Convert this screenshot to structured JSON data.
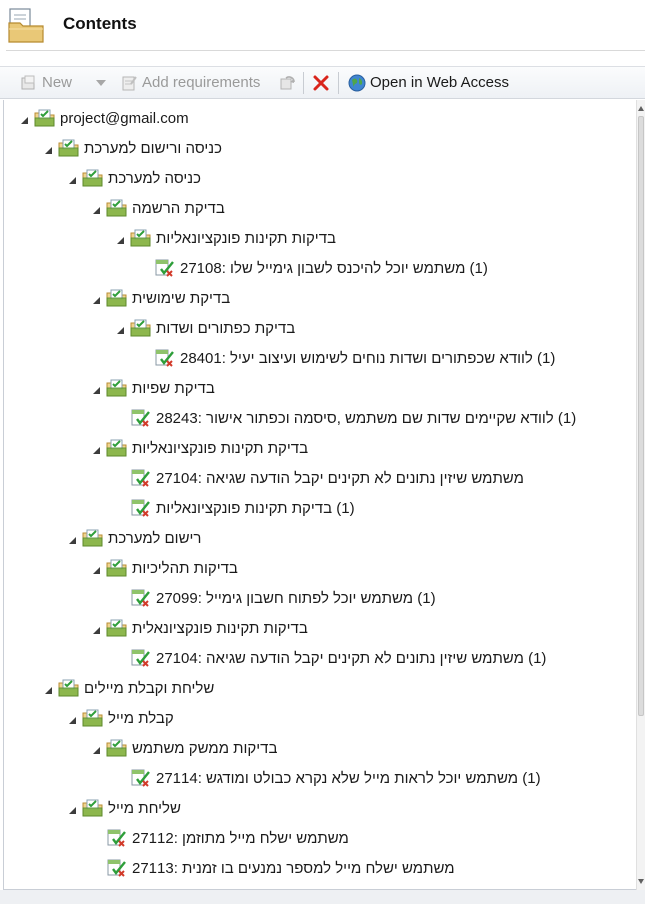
{
  "header": {
    "title": "Contents"
  },
  "toolbar": {
    "new_label": "New",
    "add_requirements_label": "Add requirements",
    "open_web_access_label": "Open in Web Access"
  },
  "tree": {
    "items": [
      {
        "label": "project@gmail.com",
        "type": "folder",
        "expanded": true,
        "level": 0
      },
      {
        "label": "כניסה ורישום למערכת",
        "type": "folder",
        "expanded": true,
        "level": 1
      },
      {
        "label": "כניסה למערכת",
        "type": "folder",
        "expanded": true,
        "level": 2
      },
      {
        "label": "בדיקת הרשמה",
        "type": "folder",
        "expanded": true,
        "level": 3
      },
      {
        "label": "בדיקות תקינות פונקציונאליות",
        "type": "folder",
        "expanded": true,
        "level": 4
      },
      {
        "label": "(1) משתמש יוכל להיכנס לשבון גימייל שלו :27108",
        "type": "test",
        "level": 5
      },
      {
        "label": "בדיקת שימושית",
        "type": "folder",
        "expanded": true,
        "level": 3
      },
      {
        "label": "בדיקת כפתורים ושדות",
        "type": "folder",
        "expanded": true,
        "level": 4
      },
      {
        "label": "(1) לוודא שכפתורים ושדות נוחים לשימוש ועיצוב יעיל :28401",
        "type": "test",
        "level": 5
      },
      {
        "label": "בדיקת שפיות",
        "type": "folder",
        "expanded": true,
        "level": 3
      },
      {
        "label": "(1) לוודא שקיימים שדות שם משתמש ,סיסמה וכפתור אישור :28243",
        "type": "test",
        "level": 4
      },
      {
        "label": "בדיקת תקינות פונקציונאליות",
        "type": "folder",
        "expanded": true,
        "level": 3
      },
      {
        "label": "משתמש שיזין נתונים לא תקינים יקבל הודעה שגיאה :27104",
        "type": "test",
        "level": 4
      },
      {
        "label": "(1) בדיקת תקינות פונקציונאליות",
        "type": "test",
        "level": 4
      },
      {
        "label": "רישום למערכת",
        "type": "folder",
        "expanded": true,
        "level": 2
      },
      {
        "label": "בדיקות תהליכיות",
        "type": "folder",
        "expanded": true,
        "level": 3
      },
      {
        "label": "(1) משתמש יוכל לפתוח חשבון גימייל :27099",
        "type": "test",
        "level": 4
      },
      {
        "label": "בדיקות תקינות פונקציונאלית",
        "type": "folder",
        "expanded": true,
        "level": 3
      },
      {
        "label": "(1) משתמש שיזין נתונים לא תקינים יקבל הודעה שגיאה :27104",
        "type": "test",
        "level": 4
      },
      {
        "label": "שליחת וקבלת מיילים",
        "type": "folder",
        "expanded": true,
        "level": 1
      },
      {
        "label": "קבלת מייל",
        "type": "folder",
        "expanded": true,
        "level": 2
      },
      {
        "label": "בדיקות ממשק משתמש",
        "type": "folder",
        "expanded": true,
        "level": 3
      },
      {
        "label": "(1) משתמש יוכל לראות מייל שלא נקרא כבולט ומודגש :27114",
        "type": "test",
        "level": 4
      },
      {
        "label": "שליחת מייל",
        "type": "folder",
        "expanded": true,
        "level": 2
      },
      {
        "label": "משתמש ישלח מייל מתוזמן :27112",
        "type": "test",
        "level": 3
      },
      {
        "label": "משתמש ישלח מייל למספר נמנעים בו זמנית :27113",
        "type": "test",
        "level": 3
      }
    ]
  },
  "colors": {
    "folder_green": "#6aa84f",
    "folder_tan": "#e8c77a",
    "check_green": "#2e9e3a",
    "check_red": "#d23a2a",
    "delete_red": "#d9241b"
  }
}
